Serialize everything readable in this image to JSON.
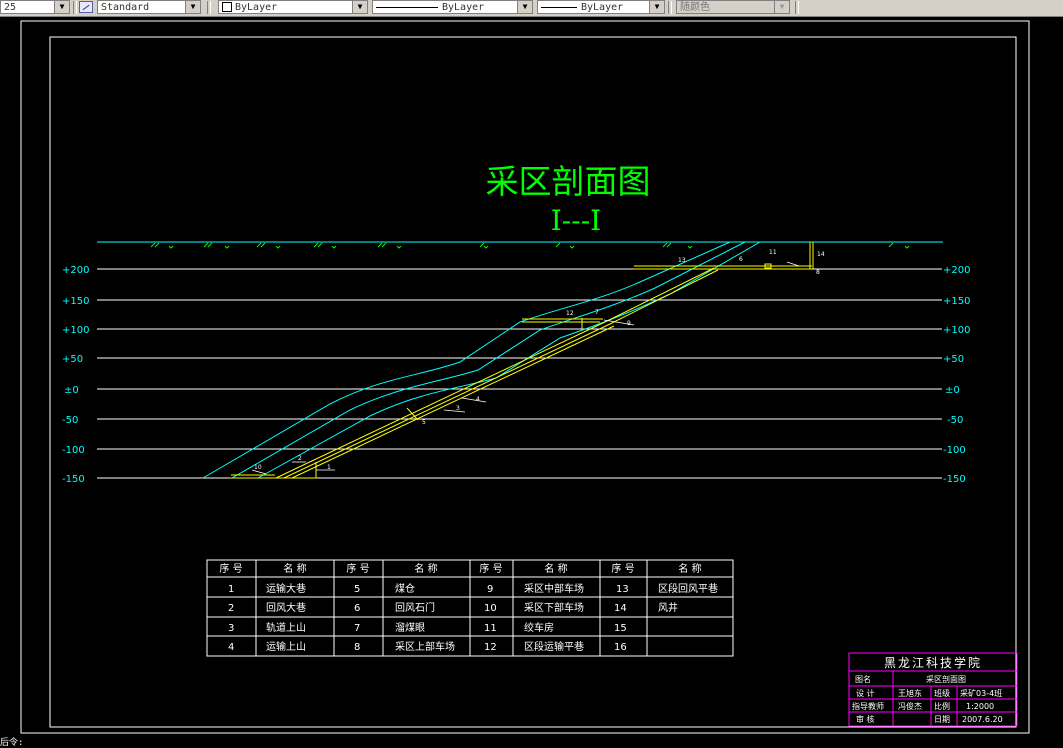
{
  "toolbar": {
    "linetype_scale": "25",
    "text_style": "Standard",
    "layer": "ByLayer",
    "linetype": "ByLayer",
    "lineweight": "ByLayer",
    "plot_style": "随颜色"
  },
  "drawing": {
    "title": "采区剖面图",
    "section": "I---I",
    "elevations_left": [
      "+200",
      "+150",
      "+100",
      "+50",
      "±0",
      "-50",
      "-100",
      "-150"
    ],
    "elevations_right": [
      "+200",
      "+150",
      "+100",
      "+50",
      "±0",
      "-50",
      "-100",
      "-150"
    ],
    "callouts": [
      "1",
      "2",
      "3",
      "4",
      "5",
      "6",
      "7",
      "8",
      "9",
      "10",
      "11",
      "12",
      "13",
      "14"
    ],
    "colors": {
      "background": "#000000",
      "seam": "#00ffff",
      "roadway": "#ffff00",
      "title": "#00ff00",
      "titleblock": "#ff00ff"
    }
  },
  "legend": {
    "headers": [
      "序 号",
      "名 称",
      "序 号",
      "名 称",
      "序 号",
      "名 称",
      "序 号",
      "名 称"
    ],
    "rows": [
      [
        "1",
        "运输大巷",
        "5",
        "煤仓",
        "9",
        "采区中部车场",
        "13",
        "区段回风平巷"
      ],
      [
        "2",
        "回风大巷",
        "6",
        "回风石门",
        "10",
        "采区下部车场",
        "14",
        "风井"
      ],
      [
        "3",
        "轨道上山",
        "7",
        "溜煤眼",
        "11",
        "绞车房",
        "15",
        ""
      ],
      [
        "4",
        "运输上山",
        "8",
        "采区上部车场",
        "12",
        "区段运输平巷",
        "16",
        ""
      ]
    ]
  },
  "title_block": {
    "school": "黑龙江科技学院",
    "drawing_name_label": "图名",
    "drawing_name": "采区剖面图",
    "design_label": "设 计",
    "designer": "王旭东",
    "class_label": "班级",
    "class": "采矿03-4班",
    "advisor_label": "指导教师",
    "advisor": "冯俊杰",
    "scale_label": "比例",
    "scale": "1:2000",
    "review_label": "审 核",
    "date_label": "日期",
    "date": "2007.6.20"
  },
  "command_line": "后令:"
}
